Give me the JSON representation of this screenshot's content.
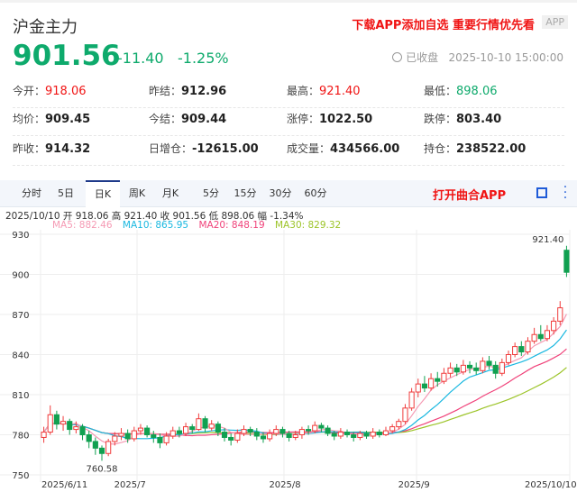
{
  "header": {
    "title": "沪金主力",
    "promo": "下载APP添加自选 重要行情优先看",
    "app_badge": "APP",
    "price": "901.56",
    "change": "-11.40",
    "change_pct": "-1.25%",
    "status": "已收盘",
    "datetime": "2025-10-10 15:00:00"
  },
  "stats": [
    [
      {
        "label": "今开：",
        "value": "918.06",
        "color": "red"
      },
      {
        "label": "昨结：",
        "value": "912.96"
      },
      {
        "label": "最高：",
        "value": "921.40",
        "color": "red"
      },
      {
        "label": "最低：",
        "value": "898.06",
        "color": "grn"
      }
    ],
    [
      {
        "label": "均价：",
        "value": "909.45"
      },
      {
        "label": "今结：",
        "value": "909.44"
      },
      {
        "label": "涨停：",
        "value": "1022.50"
      },
      {
        "label": "跌停：",
        "value": "803.40"
      }
    ],
    [
      {
        "label": "昨收：",
        "value": "914.32"
      },
      {
        "label": "日增仓：",
        "value": "-12615.00"
      },
      {
        "label": "成交量：",
        "value": "434566.00"
      },
      {
        "label": "持仓：",
        "value": "238522.00"
      }
    ]
  ],
  "tabs": [
    "分时",
    "5日",
    "日K",
    "周K",
    "月K",
    "5分",
    "15分",
    "30分",
    "60分"
  ],
  "active_tab": 2,
  "open_app": "打开曲合APP",
  "info": "2025/10/10 开 918.06 高 921.40 收 901.56 低 898.06 幅 -1.34%",
  "ma": {
    "ma5": "MA5: 882.46",
    "ma10": "MA10: 865.95",
    "ma20": "MA20: 848.19",
    "ma30": "MA30: 829.32"
  },
  "colors": {
    "up": "#f03c3c",
    "down": "#10a050",
    "ma5": "#f59ab4",
    "ma10": "#1ab8e0",
    "ma20": "#f0427a",
    "ma30": "#9cc428"
  },
  "chart_data": {
    "type": "candlestick",
    "yticks": [
      930,
      900,
      870,
      840,
      810,
      780,
      750
    ],
    "ylim": [
      750,
      930
    ],
    "xlabels": [
      {
        "label": "2025/6/11",
        "i": 2
      },
      {
        "label": "2025/7",
        "i": 13
      },
      {
        "label": "2025/8",
        "i": 37
      },
      {
        "label": "2025/9",
        "i": 57
      },
      {
        "label": "2025/10/10",
        "i": 81
      }
    ],
    "annotations": {
      "max": "921.40",
      "min": "760.58"
    },
    "candles": [
      [
        778,
        782,
        786,
        774
      ],
      [
        782,
        795,
        802,
        780
      ],
      [
        795,
        788,
        798,
        784
      ],
      [
        788,
        790,
        794,
        783
      ],
      [
        790,
        784,
        792,
        780
      ],
      [
        784,
        786,
        790,
        781
      ],
      [
        786,
        780,
        788,
        776
      ],
      [
        780,
        775,
        783,
        770
      ],
      [
        775,
        770,
        778,
        765
      ],
      [
        770,
        766,
        772,
        760.58
      ],
      [
        766,
        775,
        777,
        764
      ],
      [
        775,
        779,
        782,
        772
      ],
      [
        779,
        781,
        785,
        776
      ],
      [
        781,
        777,
        784,
        774
      ],
      [
        777,
        783,
        786,
        775
      ],
      [
        783,
        785,
        788,
        780
      ],
      [
        785,
        780,
        787,
        778
      ],
      [
        780,
        778,
        783,
        774
      ],
      [
        778,
        774,
        781,
        770
      ],
      [
        774,
        779,
        782,
        772
      ],
      [
        779,
        783,
        786,
        777
      ],
      [
        783,
        781,
        786,
        778
      ],
      [
        781,
        786,
        789,
        779
      ],
      [
        786,
        784,
        788,
        781
      ],
      [
        784,
        792,
        796,
        783
      ],
      [
        792,
        785,
        794,
        782
      ],
      [
        785,
        788,
        791,
        783
      ],
      [
        788,
        782,
        790,
        779
      ],
      [
        782,
        778,
        785,
        775
      ],
      [
        778,
        776,
        781,
        772
      ],
      [
        776,
        781,
        784,
        774
      ],
      [
        781,
        784,
        787,
        779
      ],
      [
        784,
        782,
        786,
        779
      ],
      [
        782,
        779,
        785,
        776
      ],
      [
        779,
        777,
        782,
        774
      ],
      [
        777,
        781,
        784,
        775
      ],
      [
        781,
        784,
        787,
        779
      ],
      [
        784,
        781,
        786,
        778
      ],
      [
        781,
        778,
        783,
        775
      ],
      [
        778,
        780,
        783,
        776
      ],
      [
        780,
        784,
        786,
        777
      ],
      [
        784,
        783,
        787,
        780
      ],
      [
        783,
        787,
        790,
        781
      ],
      [
        787,
        785,
        789,
        782
      ],
      [
        785,
        781,
        787,
        779
      ],
      [
        781,
        779,
        783,
        776
      ],
      [
        779,
        782,
        785,
        777
      ],
      [
        782,
        780,
        784,
        778
      ],
      [
        780,
        778,
        782,
        775
      ],
      [
        778,
        781,
        783,
        776
      ],
      [
        781,
        779,
        783,
        777
      ],
      [
        779,
        782,
        785,
        777
      ],
      [
        782,
        780,
        784,
        778
      ],
      [
        780,
        783,
        786,
        779
      ],
      [
        783,
        786,
        788,
        781
      ],
      [
        786,
        790,
        792,
        784
      ],
      [
        790,
        800,
        803,
        788
      ],
      [
        800,
        812,
        815,
        798
      ],
      [
        812,
        818,
        822,
        808
      ],
      [
        818,
        815,
        824,
        812
      ],
      [
        815,
        822,
        826,
        813
      ],
      [
        822,
        820,
        827,
        816
      ],
      [
        820,
        826,
        830,
        818
      ],
      [
        826,
        830,
        834,
        823
      ],
      [
        830,
        827,
        833,
        824
      ],
      [
        827,
        832,
        836,
        825
      ],
      [
        832,
        830,
        835,
        826
      ],
      [
        830,
        828,
        834,
        825
      ],
      [
        828,
        835,
        838,
        826
      ],
      [
        835,
        832,
        839,
        829
      ],
      [
        832,
        826,
        835,
        822
      ],
      [
        826,
        834,
        837,
        824
      ],
      [
        834,
        840,
        843,
        832
      ],
      [
        840,
        846,
        849,
        838
      ],
      [
        846,
        842,
        850,
        839
      ],
      [
        842,
        850,
        853,
        840
      ],
      [
        850,
        855,
        860,
        848
      ],
      [
        855,
        852,
        862,
        850
      ],
      [
        852,
        858,
        862,
        850
      ],
      [
        858,
        865,
        868,
        855
      ],
      [
        865,
        875,
        880,
        862
      ],
      [
        918.06,
        901.56,
        921.4,
        898.06
      ]
    ]
  }
}
